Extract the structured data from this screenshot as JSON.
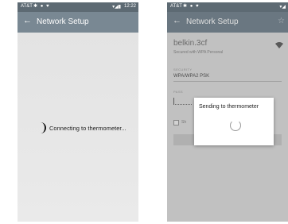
{
  "left_screen": {
    "status_bar": {
      "carrier": "AT&T",
      "time": "12:22"
    },
    "toolbar": {
      "back": "←",
      "title": "Network Setup"
    },
    "message": "Connecting to thermometer..."
  },
  "right_screen": {
    "status_bar": {
      "carrier": "AT&T"
    },
    "toolbar": {
      "back": "←",
      "title": "Network Setup",
      "favorite": "☆"
    },
    "network": {
      "name": "belkin.3cf",
      "description": "Secured with WPA Personal",
      "wifi": "wifi-icon"
    },
    "security_label": "SECURITY",
    "security_value": "WPA/WPA2 PSK",
    "password_label": "PASS",
    "show_label": "Sh",
    "dialog": {
      "title": "Sending to thermometer"
    }
  }
}
